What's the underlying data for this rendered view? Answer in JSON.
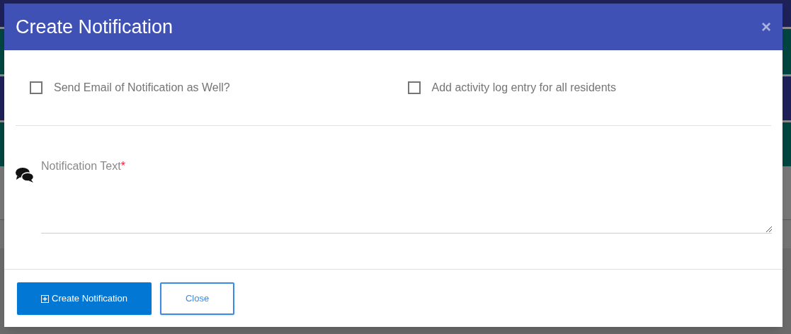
{
  "dialog": {
    "title": "Create Notification",
    "close_icon": "×"
  },
  "options": [
    {
      "label": "Send Email of Notification as Well?",
      "checked": false
    },
    {
      "label": "Add activity log entry for all residents",
      "checked": false
    }
  ],
  "notification_field": {
    "label": "Notification Text",
    "required_mark": "*"
  },
  "buttons": [
    {
      "label": "Create Notification",
      "kind": "primary"
    },
    {
      "label": "Close",
      "kind": "outline"
    }
  ]
}
